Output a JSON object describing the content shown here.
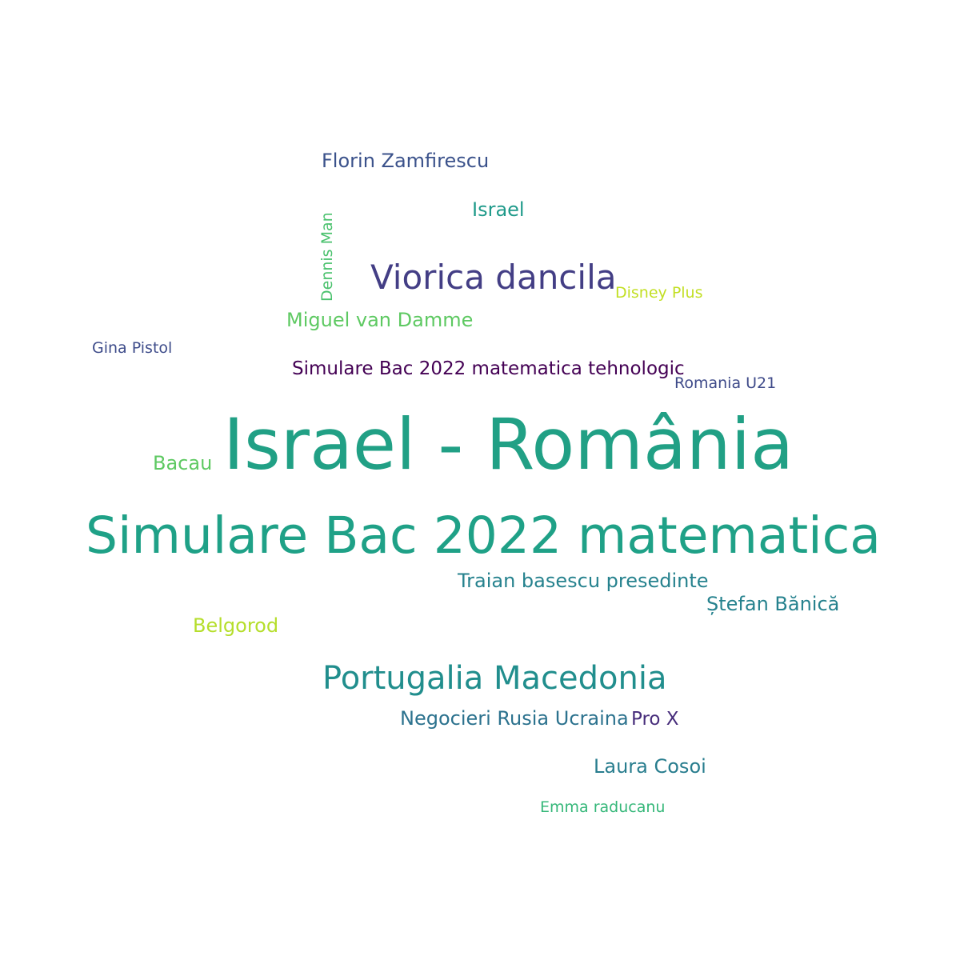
{
  "words": [
    {
      "text": "Israel - România",
      "color": "#21a085"
    },
    {
      "text": "Simulare Bac 2022 matematica",
      "color": "#1fa187"
    },
    {
      "text": "Viorica dancila",
      "color": "#433e85"
    },
    {
      "text": "Portugalia Macedonia",
      "color": "#218e8d"
    },
    {
      "text": "Simulare Bac 2022 matematica tehnologic",
      "color": "#440154"
    },
    {
      "text": "Florin Zamfirescu",
      "color": "#3b528b"
    },
    {
      "text": "Miguel van Damme",
      "color": "#5ec962"
    },
    {
      "text": "Traian basescu presedinte",
      "color": "#26828e"
    },
    {
      "text": "Ștefan Bănică",
      "color": "#26828e"
    },
    {
      "text": "Negocieri Rusia Ucraina",
      "color": "#2c728e"
    },
    {
      "text": "Laura Cosoi",
      "color": "#287d8e"
    },
    {
      "text": "Belgorod",
      "color": "#b5de2b"
    },
    {
      "text": "Israel",
      "color": "#1f9a8a"
    },
    {
      "text": "Bacau",
      "color": "#5ec962"
    },
    {
      "text": "Pro X",
      "color": "#472d7b"
    },
    {
      "text": "Disney Plus",
      "color": "#c2df23"
    },
    {
      "text": "Gina Pistol",
      "color": "#3e4c8a"
    },
    {
      "text": "Romania U21",
      "color": "#3e4a89"
    },
    {
      "text": "Emma raducanu",
      "color": "#35b779"
    },
    {
      "text": "Dennis Man",
      "color": "#4ac16d"
    }
  ]
}
